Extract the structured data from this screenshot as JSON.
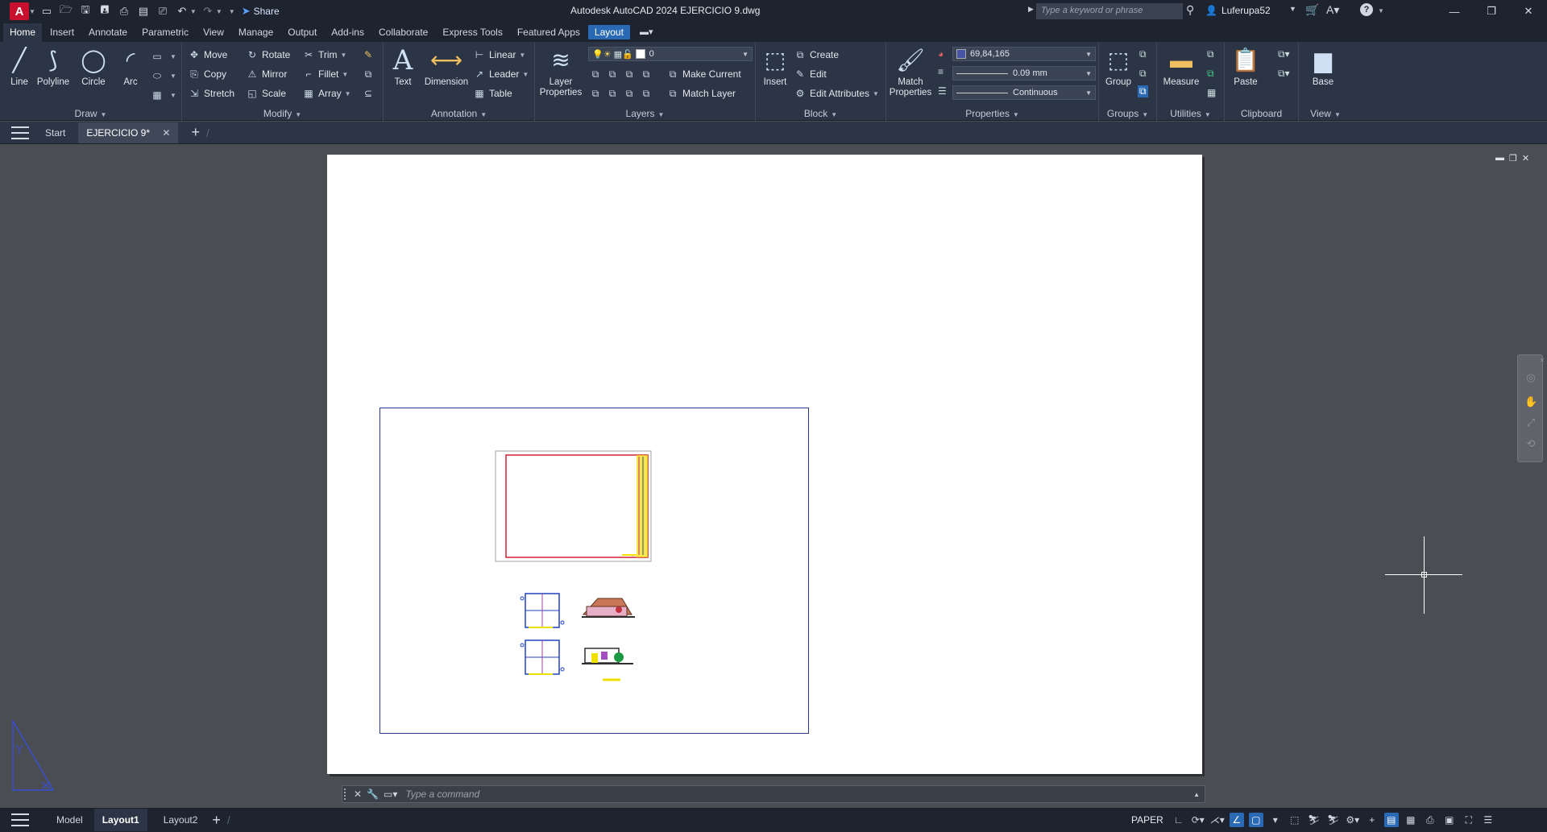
{
  "app": {
    "logo_letter": "A",
    "title": "Autodesk AutoCAD 2024    EJERCICIO 9.dwg",
    "share_label": "Share",
    "search_placeholder": "Type a keyword or phrase",
    "user": "Luferupa52"
  },
  "ribbon_tabs": [
    "Home",
    "Insert",
    "Annotate",
    "Parametric",
    "View",
    "Manage",
    "Output",
    "Add-ins",
    "Collaborate",
    "Express Tools",
    "Featured Apps",
    "Layout"
  ],
  "panels": {
    "draw": {
      "title": "Draw",
      "line": "Line",
      "polyline": "Polyline",
      "circle": "Circle",
      "arc": "Arc"
    },
    "modify": {
      "title": "Modify",
      "move": "Move",
      "rotate": "Rotate",
      "trim": "Trim",
      "copy": "Copy",
      "mirror": "Mirror",
      "fillet": "Fillet",
      "stretch": "Stretch",
      "scale": "Scale",
      "array": "Array"
    },
    "annotation": {
      "title": "Annotation",
      "text": "Text",
      "dimension": "Dimension",
      "linear": "Linear",
      "leader": "Leader",
      "table": "Table"
    },
    "layers": {
      "title": "Layers",
      "layer_properties": "Layer Properties",
      "current_layer": "0",
      "make_current": "Make Current",
      "match_layer": "Match Layer"
    },
    "block": {
      "title": "Block",
      "insert": "Insert",
      "create": "Create",
      "edit": "Edit",
      "edit_attributes": "Edit Attributes"
    },
    "properties": {
      "title": "Properties",
      "match_properties": "Match Properties",
      "color_value": "69,84,165",
      "lineweight_value": "0.09 mm",
      "linetype_value": "Continuous"
    },
    "groups": {
      "title": "Groups",
      "group": "Group"
    },
    "utilities": {
      "title": "Utilities",
      "measure": "Measure"
    },
    "clipboard": {
      "title": "Clipboard",
      "paste": "Paste"
    },
    "view": {
      "title": "View",
      "base": "Base"
    }
  },
  "doc_tabs": {
    "start": "Start",
    "active": "EJERCICIO 9*"
  },
  "command_line": {
    "placeholder": "Type  a  command"
  },
  "layout_tabs": [
    "Model",
    "Layout1",
    "Layout2"
  ],
  "status": {
    "space": "PAPER"
  },
  "colors": {
    "accent": "#2a6ab5",
    "layer_color": "#4554a5",
    "titlebar": "#1d2430",
    "ribbon": "#2c3545",
    "canvas": "#4a4d52"
  }
}
